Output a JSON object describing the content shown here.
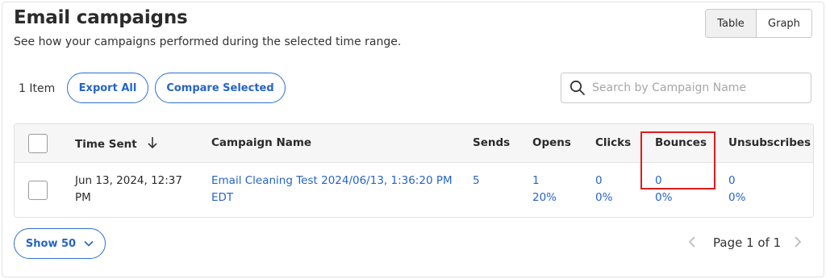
{
  "header": {
    "title": "Email campaigns",
    "subtitle": "See how your campaigns performed during the selected time range."
  },
  "view_toggle": {
    "table_label": "Table",
    "graph_label": "Graph",
    "selected": "Table"
  },
  "toolbar": {
    "item_count": "1 Item",
    "export_label": "Export All",
    "compare_label": "Compare Selected",
    "search_placeholder": "Search by Campaign Name",
    "search_icon": "search-icon"
  },
  "table": {
    "columns": {
      "time_sent": "Time Sent",
      "campaign_name": "Campaign Name",
      "sends": "Sends",
      "opens": "Opens",
      "clicks": "Clicks",
      "bounces": "Bounces",
      "unsubscribes": "Unsubscribes"
    },
    "sort_icon": "arrow-down-icon",
    "rows": [
      {
        "time_sent_line1": "Jun 13, 2024, 12:37",
        "time_sent_line2": "PM",
        "campaign_line1": "Email Cleaning Test 2024/06/13, 1:36:20 PM",
        "campaign_line2": "EDT",
        "sends": "5",
        "opens_count": "1",
        "opens_rate": "20%",
        "clicks_count": "0",
        "clicks_rate": "0%",
        "bounces_count": "0",
        "bounces_rate": "0%",
        "unsubscribes_count": "0",
        "unsubscribes_rate": "0%"
      }
    ]
  },
  "footer": {
    "show_label": "Show 50",
    "page_text": "Page 1 of 1"
  },
  "colors": {
    "accent": "#2664c7",
    "highlight": "#e01c1c"
  }
}
